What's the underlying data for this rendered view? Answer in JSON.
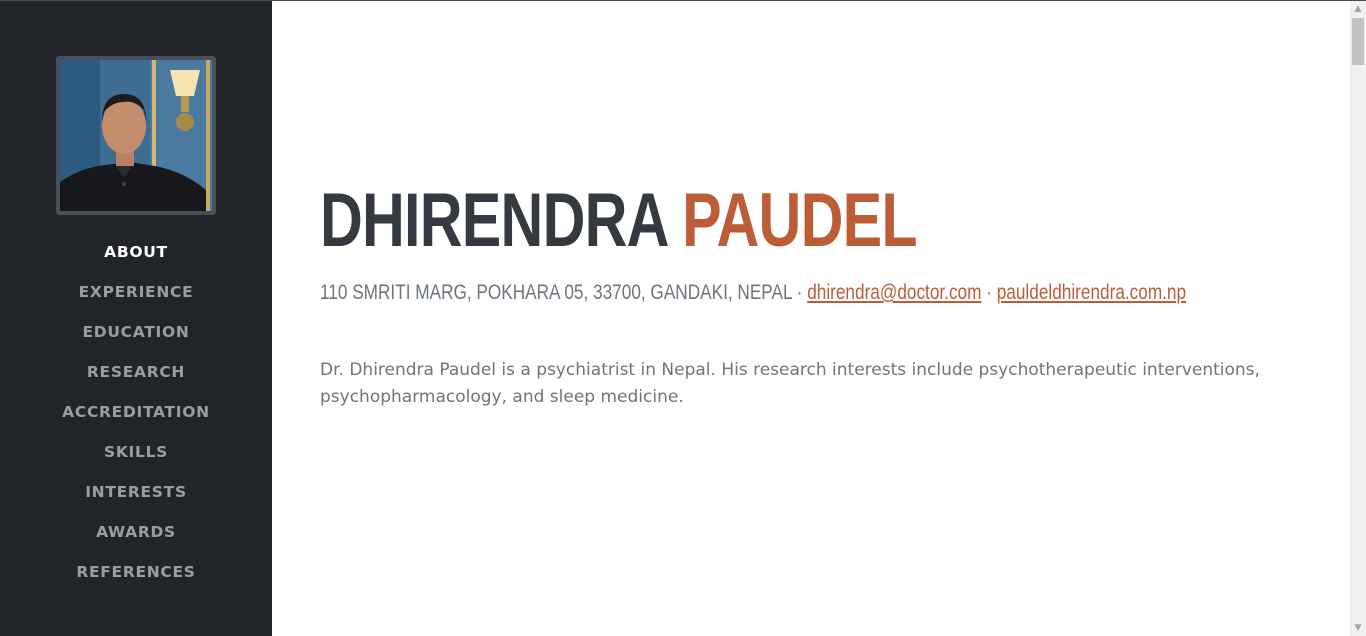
{
  "sidebar": {
    "profile_alt": "profile photo",
    "nav": [
      {
        "label": "ABOUT",
        "active": true
      },
      {
        "label": "EXPERIENCE",
        "active": false
      },
      {
        "label": "EDUCATION",
        "active": false
      },
      {
        "label": "RESEARCH",
        "active": false
      },
      {
        "label": "ACCREDITATION",
        "active": false
      },
      {
        "label": "SKILLS",
        "active": false
      },
      {
        "label": "INTERESTS",
        "active": false
      },
      {
        "label": "AWARDS",
        "active": false
      },
      {
        "label": "REFERENCES",
        "active": false
      }
    ]
  },
  "about": {
    "first_name": "DHIRENDRA",
    "last_name": "PAUDEL",
    "address": "110 SMRITI MARG, POKHARA 05, 33700, GANDAKI, NEPAL",
    "separator": " · ",
    "email": "dhirendra@doctor.com",
    "website": "pauldeldhirendra.com.np",
    "bio": "Dr. Dhirendra Paudel is a psychiatrist in Nepal. His research interests include psychotherapeutic interventions, psychopharmacology, and sleep medicine."
  },
  "colors": {
    "sidebar_bg": "#212529",
    "accent": "#bd5d38",
    "heading": "#343a40",
    "muted": "#6c757d"
  }
}
